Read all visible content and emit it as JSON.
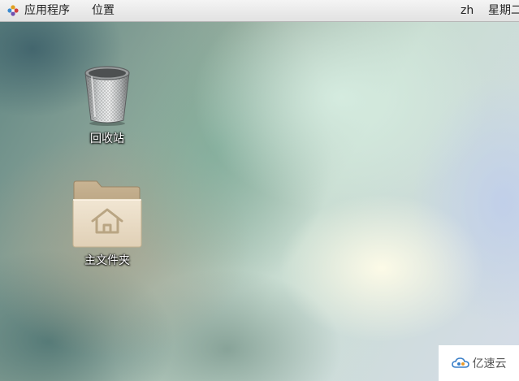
{
  "topbar": {
    "apps_label": "应用程序",
    "places_label": "位置",
    "lang": "zh",
    "clock": "星期二"
  },
  "desktop": {
    "icons": [
      {
        "label": "回收站",
        "icon": "trash-icon"
      },
      {
        "label": "主文件夹",
        "icon": "home-folder-icon"
      }
    ]
  },
  "watermark": {
    "text": "亿速云"
  }
}
